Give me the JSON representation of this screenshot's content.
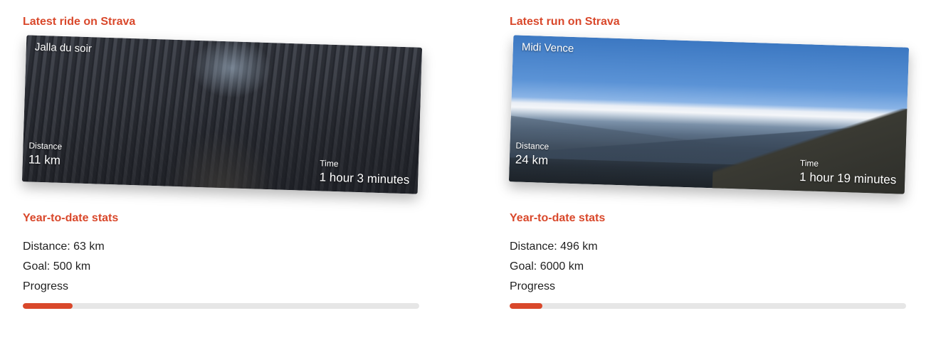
{
  "colors": {
    "accent": "#d9482b",
    "track": "#e6e6e6"
  },
  "ride": {
    "heading": "Latest ride on Strava",
    "activity_name": "Jalla du soir",
    "distance_label": "Distance",
    "distance_value": "11 km",
    "time_label": "Time",
    "time_value": "1 hour 3 minutes",
    "ytd": {
      "heading": "Year-to-date stats",
      "distance_line": "Distance: 63 km",
      "goal_line": "Goal: 500 km",
      "progress_label": "Progress",
      "progress_fraction": 0.126
    }
  },
  "run": {
    "heading": "Latest run on Strava",
    "activity_name": "Midi Vence",
    "distance_label": "Distance",
    "distance_value": "24 km",
    "time_label": "Time",
    "time_value": "1 hour 19 minutes",
    "ytd": {
      "heading": "Year-to-date stats",
      "distance_line": "Distance: 496 km",
      "goal_line": "Goal: 6000 km",
      "progress_label": "Progress",
      "progress_fraction": 0.083
    }
  }
}
